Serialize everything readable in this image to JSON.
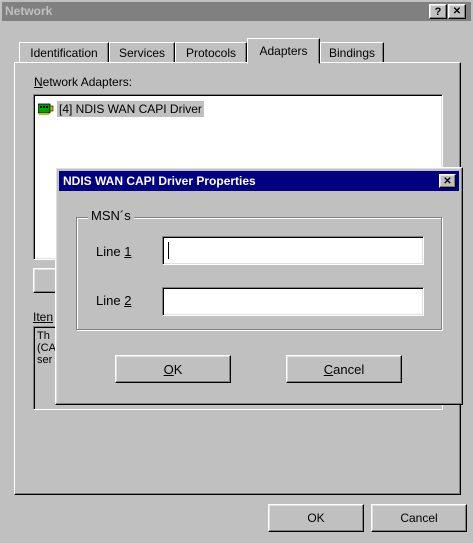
{
  "window": {
    "title": "Network",
    "help_glyph": "?",
    "close_glyph": "✕"
  },
  "tabs": [
    {
      "label": "Identification"
    },
    {
      "label": "Services"
    },
    {
      "label": "Protocols"
    },
    {
      "label": "Adapters"
    },
    {
      "label": "Bindings"
    }
  ],
  "adapters": {
    "label_prefix": "N",
    "label_rest": "etwork Adapters:",
    "items": [
      {
        "label": "[4] NDIS WAN CAPI Driver",
        "icon": "network-card-icon"
      }
    ]
  },
  "item_notes": {
    "label_partial": "Iten",
    "text_lines": [
      "Th",
      "(CA",
      "ser"
    ]
  },
  "dialog": {
    "title": "NDIS WAN CAPI Driver Properties",
    "close_glyph": "✕",
    "group_label": "MSN´s",
    "line1_label": "Line ",
    "line1_key": "1",
    "line1_value": "",
    "line2_label": "Line ",
    "line2_key": "2",
    "line2_value": "",
    "ok_key": "O",
    "ok_rest": "K",
    "cancel_key": "C",
    "cancel_rest": "ancel"
  },
  "footer": {
    "ok_label": "OK",
    "cancel_label": "Cancel"
  }
}
